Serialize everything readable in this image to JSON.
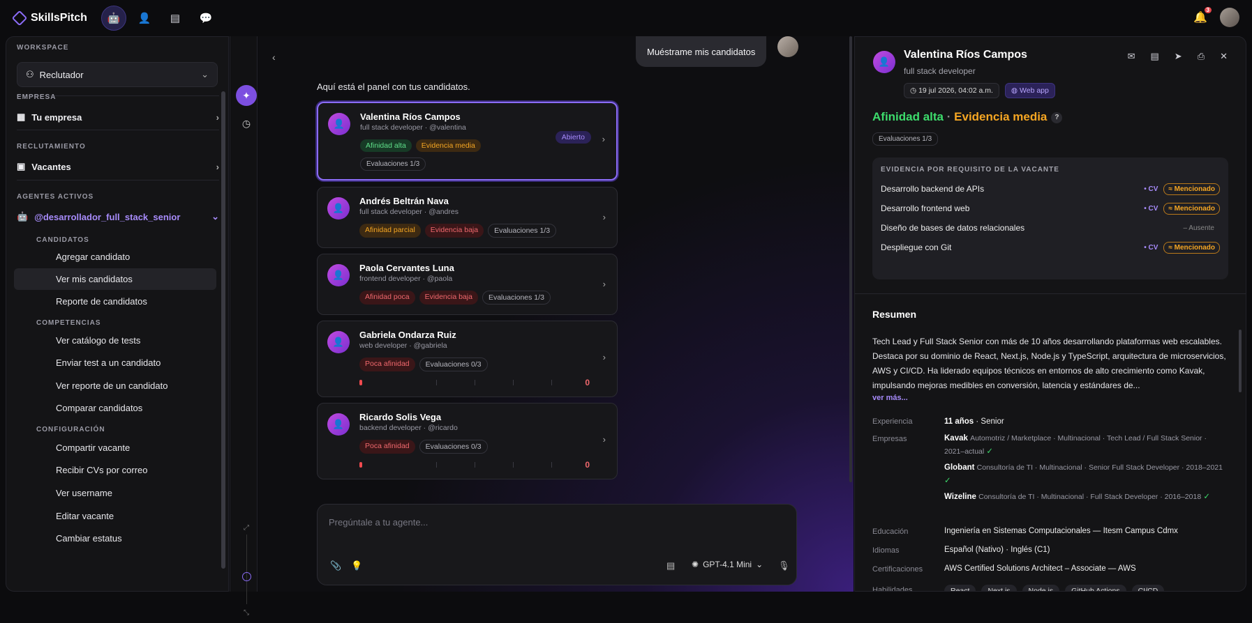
{
  "app": {
    "name": "SkillsPitch",
    "notif_count": "3"
  },
  "sidebar": {
    "workspace_title": "WORKSPACE",
    "workspace_value": "Reclutador",
    "empresa_title": "EMPRESA",
    "empresa_item": "Tu empresa",
    "recl_title": "RECLUTAMIENTO",
    "recl_item": "Vacantes",
    "agentes_title": "AGENTES ACTIVOS",
    "agent": "@desarrollador_full_stack_senior",
    "candidatos_title": "CANDIDATOS",
    "candidatos": [
      "Agregar candidato",
      "Ver mis candidatos",
      "Reporte de candidatos"
    ],
    "competencias_title": "COMPETENCIAS",
    "competencias": [
      "Ver catálogo de tests",
      "Enviar test a un candidato",
      "Ver reporte de un candidato",
      "Comparar candidatos"
    ],
    "config_title": "CONFIGURACIÓN",
    "config": [
      "Compartir vacante",
      "Recibir CVs por correo",
      "Ver username",
      "Editar vacante",
      "Cambiar estatus"
    ]
  },
  "chat": {
    "user_message": "Muéstrame mis candidatos",
    "intro": "Aquí está el panel con tus candidatos.",
    "input_placeholder": "Pregúntale a tu agente...",
    "model": "GPT-4.1 Mini",
    "cards": [
      {
        "name": "Valentina Ríos Campos",
        "sub": "full stack developer · @valentina",
        "tag1": "Afinidad alta",
        "tag2": "Evidencia media",
        "eval": "Evaluaciones 1/3",
        "badge": "Abierto"
      },
      {
        "name": "Andrés Beltrán Nava",
        "sub": "full stack developer · @andres",
        "tag1": "Afinidad parcial",
        "tag2": "Evidencia baja",
        "eval": "Evaluaciones 1/3"
      },
      {
        "name": "Paola Cervantes Luna",
        "sub": "frontend developer · @paola",
        "tag1": "Afinidad poca",
        "tag2": "Evidencia baja",
        "eval": "Evaluaciones 1/3"
      },
      {
        "name": "Gabriela Ondarza Ruiz",
        "sub": "web developer · @gabriela",
        "tag1": "Poca afinidad",
        "eval": "Evaluaciones 0/3",
        "score": "0"
      },
      {
        "name": "Ricardo Solis Vega",
        "sub": "backend developer · @ricardo",
        "tag1": "Poca afinidad",
        "eval": "Evaluaciones 0/3",
        "score": "0"
      }
    ]
  },
  "panel": {
    "name": "Valentina Ríos Campos",
    "role": "full stack developer",
    "date": "19 jul 2026, 04:02 a.m.",
    "source": "Web app",
    "aff_a": "Afinidad alta",
    "aff_sep": "·",
    "aff_b": "Evidencia media",
    "help": "?",
    "evals": "Evaluaciones 1/3",
    "evi_title": "EVIDENCIA POR REQUISITO DE LA VACANTE",
    "evi": [
      {
        "req": "Desarrollo backend de APIs",
        "cv": "• CV",
        "status": "≈ Mencionado"
      },
      {
        "req": "Desarrollo frontend web",
        "cv": "• CV",
        "status": "≈ Mencionado"
      },
      {
        "req": "Diseño de bases de datos relacionales",
        "status": "– Ausente"
      },
      {
        "req": "Despliegue con Git",
        "cv": "• CV",
        "status": "≈ Mencionado"
      }
    ],
    "resumen_title": "Resumen",
    "resumen": "Tech Lead y Full Stack Senior con más de 10 años desarrollando plataformas web escalables. Destaca por su dominio de React, Next.js, Node.js y TypeScript, arquitectura de microservicios, AWS y CI/CD. Ha liderado equipos técnicos en entornos de alto crecimiento como Kavak, impulsando mejoras medibles en conversión, latencia y estándares de...",
    "ver_mas": "ver más...",
    "exp_l": "Experiencia",
    "exp_v": "11 años",
    "exp_s": "· Senior",
    "emp_l": "Empresas",
    "emp": [
      {
        "n": "Kavak",
        "d": "Automotriz / Marketplace · Multinacional · Tech Lead / Full Stack Senior · 2021–actual"
      },
      {
        "n": "Globant",
        "d": "Consultoría de TI · Multinacional · Senior Full Stack Developer · 2018–2021"
      },
      {
        "n": "Wizeline",
        "d": "Consultoría de TI · Multinacional · Full Stack Developer · 2016–2018"
      }
    ],
    "edu_l": "Educación",
    "edu_v": "Ingeniería en Sistemas Computacionales — Itesm Campus Cdmx",
    "idi_l": "Idiomas",
    "idi_v": "Español (Nativo) · Inglés (C1)",
    "cert_l": "Certificaciones",
    "cert_v": "AWS Certified Solutions Architect – Associate — AWS",
    "hab_l": "Habilidades",
    "skills": [
      "React",
      "Next.js",
      "Node.js",
      "GitHub Actions",
      "CI/CD"
    ]
  }
}
